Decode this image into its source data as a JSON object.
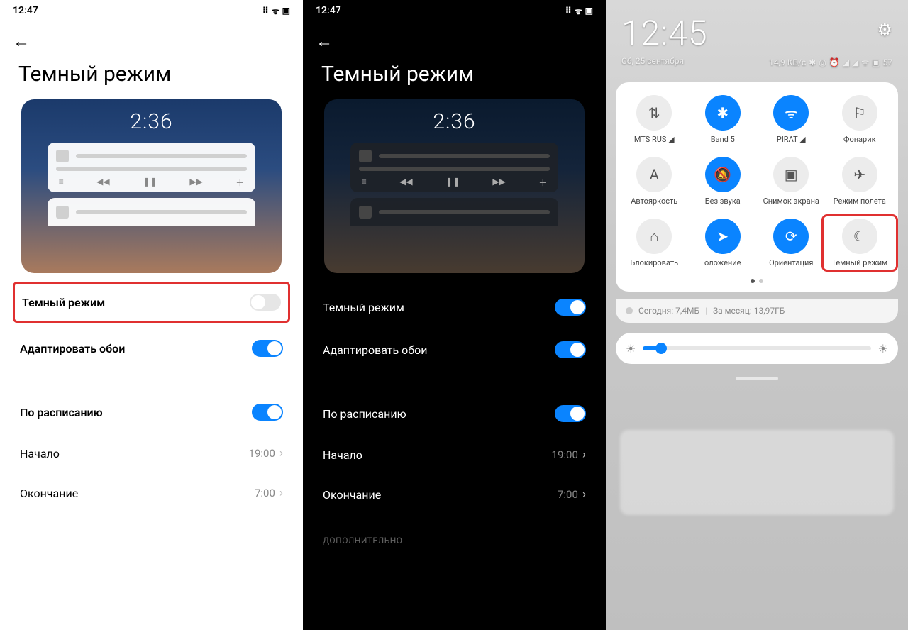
{
  "settings": {
    "title": "Темный режим",
    "rows": {
      "dark_mode": "Темный режим",
      "adapt_wallpaper": "Адаптировать обои",
      "schedule": "По расписанию",
      "start": "Начало",
      "end": "Окончание",
      "additional": "ДОПОЛНИТЕЛЬНО"
    },
    "values": {
      "start": "19:00",
      "end": "7:00"
    },
    "preview_time": "2:36"
  },
  "status": {
    "time12": "12:47"
  },
  "panel": {
    "time": "12:45",
    "date": "Сб, 25 сентября",
    "speed": "14,9 КБ/с",
    "battery": "57",
    "usage": {
      "today": "Сегодня: 7,4МБ",
      "month": "За месяц: 13,97ГБ"
    },
    "tiles": [
      {
        "icon": "⇅",
        "label": "MTS RUS",
        "sub": "◢",
        "active": false
      },
      {
        "icon": "✱",
        "label": "Band 5",
        "sub": "",
        "active": true,
        "iconName": "bluetooth-icon"
      },
      {
        "icon": "ᯤ",
        "label": "PIRAT",
        "sub": "◢",
        "active": true,
        "iconName": "wifi-icon"
      },
      {
        "icon": "⚐",
        "label": "Фонарик",
        "active": false,
        "iconName": "flashlight-icon"
      },
      {
        "icon": "A",
        "label": "Автояркость",
        "active": false,
        "iconName": "auto-brightness-icon"
      },
      {
        "icon": "🔕",
        "label": "Без звука",
        "active": true,
        "iconName": "mute-icon"
      },
      {
        "icon": "▣",
        "label": "Снимок экрана",
        "active": false,
        "iconName": "screenshot-icon"
      },
      {
        "icon": "✈",
        "label": "Режим полета",
        "active": false,
        "iconName": "airplane-icon"
      },
      {
        "icon": "⌂",
        "label": "Блокировать",
        "active": false,
        "iconName": "lock-icon"
      },
      {
        "icon": "➤",
        "label": "оложение",
        "active": true,
        "iconName": "location-icon"
      },
      {
        "icon": "⟳",
        "label": "Ориентация",
        "active": true,
        "iconName": "orientation-icon"
      },
      {
        "icon": "☾",
        "label": "Темный режим",
        "active": false,
        "highlight": true,
        "iconName": "dark-mode-icon"
      }
    ]
  }
}
